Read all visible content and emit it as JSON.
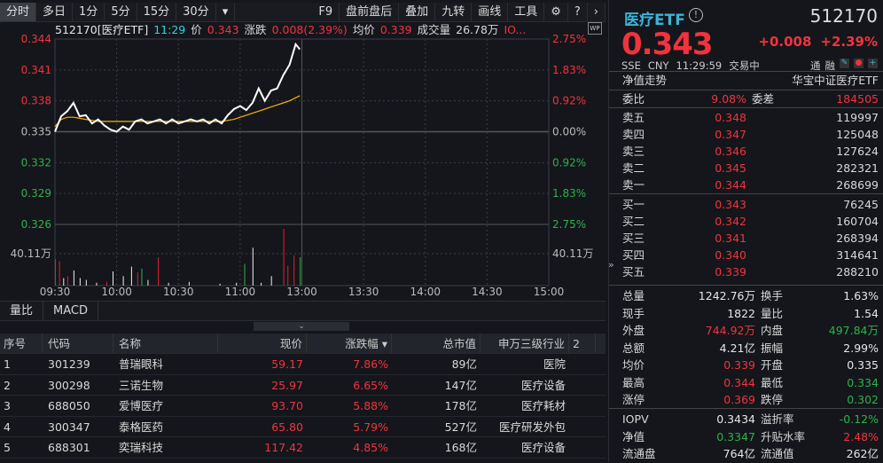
{
  "toolbar": {
    "left": [
      "分时",
      "多日",
      "1分",
      "5分",
      "15分",
      "30分",
      "▾"
    ],
    "right": [
      "F9",
      "盘前盘后",
      "叠加",
      "九转",
      "画线",
      "工具"
    ],
    "icons": [
      "gear-icon",
      "help-icon",
      "chevron-right-icon"
    ]
  },
  "info": {
    "code_name": "512170[医疗ETF]",
    "time": "11:29",
    "price_label": "价",
    "price": "0.343",
    "change_label": "涨跌",
    "change": "0.008(2.39%)",
    "avg_label": "均价",
    "avg": "0.339",
    "vol_label": "成交量",
    "vol": "26.78万",
    "more": "IO..."
  },
  "chart_data": {
    "type": "line",
    "title": "512170 医疗ETF 分时",
    "x_ticks": [
      "09:30",
      "10:00",
      "10:30",
      "11:00",
      "13:00",
      "13:30",
      "14:00",
      "14:30",
      "15:00"
    ],
    "y_left_ticks": [
      "0.344",
      "0.341",
      "0.338",
      "0.335",
      "0.332",
      "0.329",
      "0.326"
    ],
    "y_right_ticks": [
      "2.75%",
      "1.83%",
      "0.92%",
      "0.00%",
      "0.92%",
      "1.83%",
      "2.75%"
    ],
    "ylim": [
      0.326,
      0.344
    ],
    "prev_close": 0.335,
    "volume_tick": "40.11万",
    "volume_max": 60,
    "minutes": [
      0,
      3,
      6,
      9,
      12,
      15,
      18,
      21,
      24,
      27,
      30,
      33,
      36,
      39,
      42,
      45,
      48,
      51,
      54,
      57,
      60,
      63,
      66,
      69,
      72,
      75,
      78,
      81,
      84,
      87,
      90,
      93,
      96,
      99,
      102,
      105,
      108,
      111,
      114,
      117,
      119
    ],
    "price": [
      0.335,
      0.3365,
      0.337,
      0.3378,
      0.3365,
      0.3366,
      0.3358,
      0.3362,
      0.3356,
      0.3352,
      0.335,
      0.3355,
      0.3352,
      0.336,
      0.3362,
      0.3358,
      0.336,
      0.3362,
      0.3358,
      0.3362,
      0.3358,
      0.336,
      0.3362,
      0.336,
      0.3362,
      0.3358,
      0.3362,
      0.3358,
      0.3366,
      0.3372,
      0.3375,
      0.3371,
      0.3378,
      0.3392,
      0.338,
      0.339,
      0.3392,
      0.3405,
      0.3415,
      0.3435,
      0.343
    ],
    "avg": [
      0.3355,
      0.3362,
      0.3364,
      0.3364,
      0.3363,
      0.3362,
      0.3361,
      0.336,
      0.336,
      0.336,
      0.336,
      0.336,
      0.336,
      0.336,
      0.336,
      0.336,
      0.336,
      0.336,
      0.336,
      0.336,
      0.336,
      0.336,
      0.336,
      0.336,
      0.336,
      0.336,
      0.336,
      0.336,
      0.3361,
      0.3362,
      0.3364,
      0.3366,
      0.3368,
      0.337,
      0.3372,
      0.3374,
      0.3376,
      0.3378,
      0.338,
      0.3383,
      0.3385
    ],
    "volume": [
      {
        "m": 0,
        "v": 28,
        "c": "r"
      },
      {
        "m": 2,
        "v": 26,
        "c": "r"
      },
      {
        "m": 4,
        "v": 8,
        "c": "w"
      },
      {
        "m": 6,
        "v": 10,
        "c": "r"
      },
      {
        "m": 9,
        "v": 16,
        "c": "w"
      },
      {
        "m": 12,
        "v": 8,
        "c": "w"
      },
      {
        "m": 15,
        "v": 6,
        "c": "w"
      },
      {
        "m": 20,
        "v": 3,
        "c": "w"
      },
      {
        "m": 25,
        "v": 4,
        "c": "r"
      },
      {
        "m": 28,
        "v": 15,
        "c": "w"
      },
      {
        "m": 33,
        "v": 10,
        "c": "w"
      },
      {
        "m": 37,
        "v": 20,
        "c": "w"
      },
      {
        "m": 40,
        "v": 14,
        "c": "r"
      },
      {
        "m": 42,
        "v": 18,
        "c": "g"
      },
      {
        "m": 45,
        "v": 6,
        "c": "w"
      },
      {
        "m": 50,
        "v": 30,
        "c": "r"
      },
      {
        "m": 55,
        "v": 3,
        "c": "w"
      },
      {
        "m": 65,
        "v": 4,
        "c": "w"
      },
      {
        "m": 80,
        "v": 2,
        "c": "w"
      },
      {
        "m": 88,
        "v": 3,
        "c": "w"
      },
      {
        "m": 92,
        "v": 23,
        "c": "g"
      },
      {
        "m": 96,
        "v": 40,
        "c": "w"
      },
      {
        "m": 100,
        "v": 3,
        "c": "w"
      },
      {
        "m": 105,
        "v": 10,
        "c": "w"
      },
      {
        "m": 111,
        "v": 60,
        "c": "r"
      },
      {
        "m": 113,
        "v": 21,
        "c": "r"
      },
      {
        "m": 116,
        "v": 32,
        "c": "r"
      },
      {
        "m": 119,
        "v": 30,
        "c": "g"
      }
    ]
  },
  "subtabs": [
    "量比",
    "MACD"
  ],
  "table": {
    "headers": [
      "序号",
      "代码",
      "名称",
      "现价",
      "涨跌幅 ▾",
      "总市值",
      "申万三级行业",
      "2"
    ],
    "rows": [
      [
        "1",
        "301239",
        "普瑞眼科",
        "59.17",
        "7.86%",
        "89亿",
        "医院"
      ],
      [
        "2",
        "300298",
        "三诺生物",
        "25.97",
        "6.65%",
        "147亿",
        "医疗设备"
      ],
      [
        "3",
        "688050",
        "爱博医疗",
        "93.70",
        "5.88%",
        "178亿",
        "医疗耗材"
      ],
      [
        "4",
        "300347",
        "泰格医药",
        "65.80",
        "5.79%",
        "527亿",
        "医疗研发外包"
      ],
      [
        "5",
        "688301",
        "奕瑞科技",
        "117.42",
        "4.85%",
        "168亿",
        "医疗设备"
      ]
    ]
  },
  "quote": {
    "name": "医疗ETF",
    "info_icon": "!",
    "code": "512170",
    "price": "0.343",
    "change": "+0.008",
    "pct": "+2.39%",
    "exchange": "SSE",
    "currency": "CNY",
    "time": "11:29:59",
    "status": "交易中",
    "tags": [
      "通",
      "融"
    ],
    "nav_trend": "净值走势",
    "index_name": "华宝中证医疗ETF",
    "weibi_label": "委比",
    "weibi": "9.08%",
    "weicha_label": "委差",
    "weicha": "184505",
    "asks": [
      [
        "卖五",
        "0.348",
        "119997"
      ],
      [
        "卖四",
        "0.347",
        "125048"
      ],
      [
        "卖三",
        "0.346",
        "127624"
      ],
      [
        "卖二",
        "0.345",
        "282321"
      ],
      [
        "卖一",
        "0.344",
        "268699"
      ]
    ],
    "bids": [
      [
        "买一",
        "0.343",
        "76245"
      ],
      [
        "买二",
        "0.342",
        "160704"
      ],
      [
        "买三",
        "0.341",
        "268394"
      ],
      [
        "买四",
        "0.340",
        "314641"
      ],
      [
        "买五",
        "0.339",
        "288210"
      ]
    ],
    "stats": [
      [
        "总量",
        "1242.76万",
        "w",
        "换手",
        "1.63%",
        "w"
      ],
      [
        "现手",
        "1822",
        "w",
        "量比",
        "1.54",
        "w"
      ],
      [
        "外盘",
        "744.92万",
        "r",
        "内盘",
        "497.84万",
        "g"
      ],
      [
        "总额",
        "4.21亿",
        "w",
        "振幅",
        "2.99%",
        "w"
      ],
      [
        "均价",
        "0.339",
        "r",
        "开盘",
        "0.335",
        "w"
      ],
      [
        "最高",
        "0.344",
        "r",
        "最低",
        "0.334",
        "g"
      ],
      [
        "涨停",
        "0.369",
        "r",
        "跌停",
        "0.302",
        "g"
      ]
    ],
    "etf": [
      [
        "IOPV",
        "0.3434",
        "w",
        "溢折率",
        "-0.12%",
        "g"
      ],
      [
        "净值",
        "0.3347",
        "g",
        "升贴水率",
        "2.48%",
        "r"
      ],
      [
        "流通盘",
        "764亿",
        "w",
        "流通值",
        "262亿",
        "w"
      ]
    ]
  }
}
